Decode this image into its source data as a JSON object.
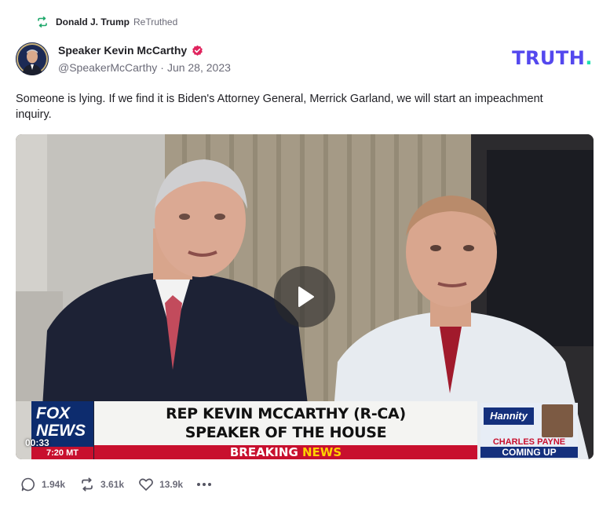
{
  "retruth": {
    "icon": "retruth-icon",
    "name": "Donald J. Trump",
    "action": "ReTruthed"
  },
  "author": {
    "name": "Speaker Kevin McCarthy",
    "verified_icon": "verified-badge-icon",
    "handle": "@SpeakerMcCarthy",
    "separator": "·",
    "date": "Jun 28, 2023"
  },
  "brand": {
    "logo_text": "TRUTH",
    "logo_dot": ".",
    "color": "#5448ee",
    "dot_color": "#1fe0b0"
  },
  "post": {
    "text": "Someone is lying. If we find it is Biden's Attorney General, Merrick Garland, we will start an impeachment inquiry."
  },
  "video": {
    "play_icon": "play-icon",
    "time": "00:33",
    "overlay": {
      "network_line1": "FOX",
      "network_line2": "NEWS",
      "clock": "7:20 MT",
      "headline_line1": "REP KEVIN MCCARTHY (R-CA)",
      "headline_line2": "SPEAKER OF THE HOUSE",
      "breaking_word": "BREAKING ",
      "news_word": "NEWS",
      "show_name": "Hannity",
      "anchor_name": "CHARLES PAYNE",
      "coming_up": "COMING UP"
    }
  },
  "actions": {
    "replies": {
      "icon": "reply-icon",
      "count": "1.94k"
    },
    "retruths": {
      "icon": "retruth-icon",
      "count": "3.61k"
    },
    "likes": {
      "icon": "heart-icon",
      "count": "13.9k"
    },
    "more_icon": "more-icon"
  },
  "colors": {
    "accent_green": "#1fa86b",
    "verified_pink": "#e0245e",
    "breaking_red": "#c8102e",
    "fox_blue": "#0d2c6e"
  }
}
